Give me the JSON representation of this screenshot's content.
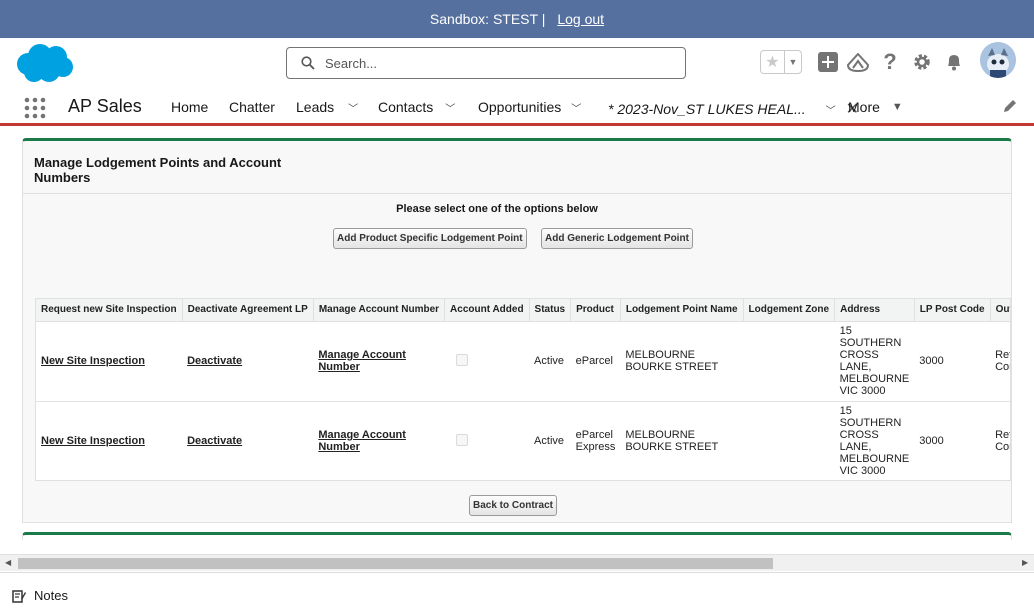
{
  "sandbox": {
    "text": "Sandbox: STEST |",
    "logout": "Log out"
  },
  "search": {
    "placeholder": "Search..."
  },
  "nav": {
    "app_name": "AP Sales",
    "home": "Home",
    "chatter": "Chatter",
    "leads": "Leads",
    "contacts": "Contacts",
    "opportunities": "Opportunities",
    "active_tab": "* 2023-Nov_ST LUKES HEAL...",
    "more": "More"
  },
  "panel": {
    "title": "Manage Lodgement Points and Account Numbers",
    "instructions": "Please select one of the options below",
    "btn_product_specific": "Add Product Specific Lodgement Point",
    "btn_generic": "Add Generic Lodgement Point",
    "btn_back": "Back to Contract"
  },
  "table": {
    "headers": [
      "Request new Site Inspection",
      "Deactivate Agreement LP",
      "Manage Account Number",
      "Account Added",
      "Status",
      "Product",
      "Lodgement Point Name",
      "Lodgement Zone",
      "Address",
      "LP Post Code",
      "Outlet Type"
    ],
    "rows": [
      {
        "inspection": "New Site Inspection",
        "deactivate": "Deactivate",
        "manage": "Manage Account Number",
        "status": "Active",
        "product": "eParcel",
        "lp_name": "MELBOURNE BOURKE STREET",
        "zone": "",
        "address": "15 SOUTHERN CROSS LANE, MELBOURNE VIC 3000",
        "post_code": "3000",
        "outlet": "Retail - Corp"
      },
      {
        "inspection": "New Site Inspection",
        "deactivate": "Deactivate",
        "manage": "Manage Account Number",
        "status": "Active",
        "product": "eParcel Express",
        "lp_name": "MELBOURNE BOURKE STREET",
        "zone": "",
        "address": "15 SOUTHERN CROSS LANE, MELBOURNE VIC 3000",
        "post_code": "3000",
        "outlet": "Retail - Corp"
      }
    ]
  },
  "footer": {
    "notes": "Notes"
  },
  "colors": {
    "sandbox_bar": "#55709e",
    "accent_green": "#1b7a4a",
    "nav_underline": "#c23934",
    "salesforce_blue": "#00a1e0"
  },
  "icons": [
    "salesforce-logo",
    "search-icon",
    "star-icon",
    "add-icon",
    "trailhead-icon",
    "help-icon",
    "gear-icon",
    "bell-icon",
    "waffle-icon",
    "chevron-down-icon",
    "close-icon",
    "pencil-icon",
    "notes-icon"
  ]
}
